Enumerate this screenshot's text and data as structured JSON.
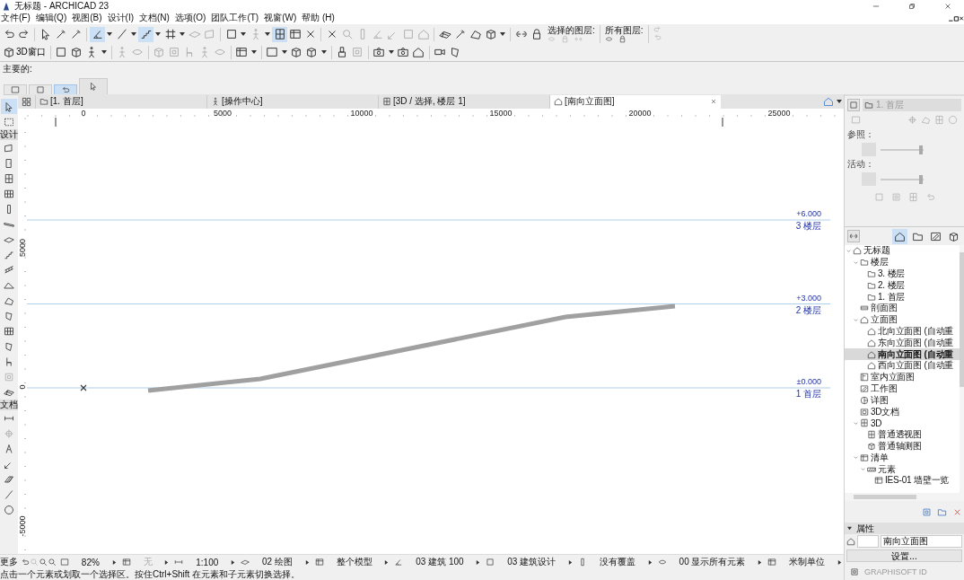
{
  "window": {
    "title": "无标题 - ARCHICAD 23"
  },
  "menu": [
    "文件(F)",
    "编辑(Q)",
    "视图(B)",
    "设计(I)",
    "文档(N)",
    "选项(O)",
    "团队工作(T)",
    "视窗(W)",
    "帮助 (H)"
  ],
  "toolbar": {
    "toggles": [
      {
        "selected": true
      },
      {
        "selected": true
      },
      {
        "selected": true
      }
    ],
    "window_3d_button": "3D窗口",
    "selected_layers_label": "选择的图层:",
    "all_layers_label": "所有图层:"
  },
  "info_box": {
    "label": "主要的:",
    "mode_buttons": [
      {
        "selected": false
      },
      {
        "selected": false
      },
      {
        "selected": true
      }
    ]
  },
  "tabs": [
    {
      "label": "[1. 首层]",
      "selected": false
    },
    {
      "label": "[操作中心]",
      "selected": false
    },
    {
      "label": "[3D / 选择, 楼层 1]",
      "selected": false
    },
    {
      "label": "[南向立面图]",
      "selected": true
    }
  ],
  "toolbox": {
    "pointer_selected": true,
    "sections": [
      "设计",
      "文档"
    ]
  },
  "ruler": {
    "x_labels": [
      "0",
      "5000",
      "10000",
      "15000",
      "20000",
      "25000"
    ],
    "y_labels": [
      "5000",
      "0",
      "-5000"
    ]
  },
  "levels": [
    {
      "elevation": "+6.000",
      "name": "3 楼层"
    },
    {
      "elevation": "+3.000",
      "name": "2 楼层"
    },
    {
      "elevation": "±0.000",
      "name": "1 首层"
    }
  ],
  "navigator": {
    "current": "1. 首层",
    "reference_label": "参照：",
    "active_label": "活动：",
    "reference_slider": {
      "level": 0.93
    },
    "active_slider": {
      "level": 0.93
    },
    "map_tabs": [
      {
        "selected": true
      },
      {
        "selected": false
      },
      {
        "selected": false
      },
      {
        "selected": false
      }
    ]
  },
  "project_tree": [
    {
      "label": "无标题",
      "kind": "project",
      "selected": false,
      "expanded": true,
      "children": [
        {
          "label": "楼层",
          "kind": "folder",
          "selected": false,
          "expanded": true,
          "children": [
            {
              "label": "3. 楼层",
              "kind": "story",
              "selected": false
            },
            {
              "label": "2. 楼层",
              "kind": "story",
              "selected": false
            },
            {
              "label": "1. 首层",
              "kind": "story",
              "selected": false
            }
          ]
        },
        {
          "label": "剖面图",
          "kind": "section",
          "selected": false
        },
        {
          "label": "立面图",
          "kind": "elevation",
          "selected": false,
          "expanded": true,
          "children": [
            {
              "label": "北向立面图 (自动重",
              "kind": "elevation",
              "selected": false
            },
            {
              "label": "东向立面图 (自动重",
              "kind": "elevation",
              "selected": false
            },
            {
              "label": "南向立面图 (自动重",
              "kind": "elevation",
              "selected": true
            },
            {
              "label": "西向立面图 (自动重",
              "kind": "elevation",
              "selected": false
            }
          ]
        },
        {
          "label": "室内立面图",
          "kind": "interior",
          "selected": false
        },
        {
          "label": "工作图",
          "kind": "worksheet",
          "selected": false
        },
        {
          "label": "详图",
          "kind": "detail",
          "selected": false
        },
        {
          "label": "3D文档",
          "kind": "doc3d",
          "selected": false
        },
        {
          "label": "3D",
          "kind": "model3d",
          "selected": false,
          "expanded": true,
          "children": [
            {
              "label": "普通透视图",
              "kind": "model3d",
              "selected": false
            },
            {
              "label": "普通轴测图",
              "kind": "axon",
              "selected": false
            }
          ]
        },
        {
          "label": "清单",
          "kind": "schedule",
          "selected": false,
          "expanded": true,
          "children": [
            {
              "label": "元素",
              "kind": "category",
              "selected": false,
              "expanded": true,
              "children": [
                {
                  "label": "IES-01 墙壁一览",
                  "kind": "schedule",
                  "selected": false
                }
              ]
            }
          ]
        }
      ]
    }
  ],
  "properties": {
    "title": "属性",
    "name": "南向立面图",
    "settings_button": "设置..."
  },
  "status_bar": {
    "more": "更多",
    "items": [
      {
        "text": "82%",
        "disabled": false
      },
      {
        "text": "无",
        "disabled": true
      },
      {
        "text": "1:100",
        "disabled": false
      },
      {
        "text": "02 绘图",
        "disabled": false
      },
      {
        "text": "整个模型",
        "disabled": false
      },
      {
        "text": "03 建筑 100",
        "disabled": false
      },
      {
        "text": "03 建筑设计",
        "disabled": false
      },
      {
        "text": "没有覆盖",
        "disabled": false
      },
      {
        "text": "00 显示所有元素",
        "disabled": false
      },
      {
        "text": "米制单位",
        "disabled": false
      }
    ]
  },
  "message": "点击一个元素或划取一个选择区。按住Ctrl+Shift 在元素和子元素切换选择。",
  "graphisoft_id": "GRAPHISOFT ID"
}
